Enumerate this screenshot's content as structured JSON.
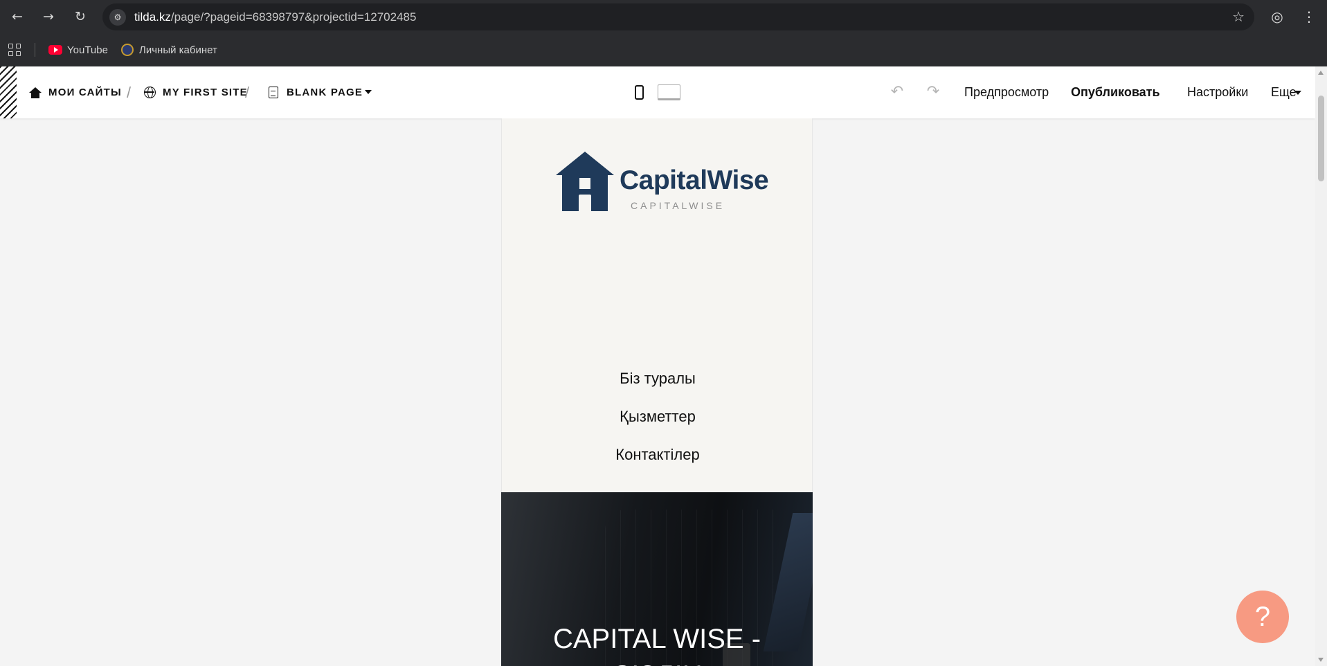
{
  "browser": {
    "url_host": "tilda.kz",
    "url_path": "/page/?pageid=68398797&projectid=12702485",
    "bookmarks": [
      {
        "label": "YouTube",
        "icon": "youtube-icon"
      },
      {
        "label": "Личный кабинет",
        "icon": "cabinet-icon"
      }
    ]
  },
  "editor": {
    "breadcrumbs": {
      "my_sites": "МОИ САЙТЫ",
      "site": "MY FIRST SITE",
      "page": "BLANK PAGE"
    },
    "actions": {
      "preview": "Предпросмотр",
      "publish": "Опубликовать",
      "settings": "Настройки",
      "more": "Еще"
    }
  },
  "site_preview": {
    "logo": {
      "name": "CapitalWise",
      "subtitle": "CAPITALWISE",
      "color": "#1f3a5a"
    },
    "menu": [
      "Біз туралы",
      "Қызметтер",
      "Контактілер"
    ],
    "hero": {
      "title_line1": "CAPITAL WISE -",
      "title_line2": "СІЗДІҢ"
    }
  },
  "help": {
    "label": "?",
    "color": "#f79a82"
  }
}
